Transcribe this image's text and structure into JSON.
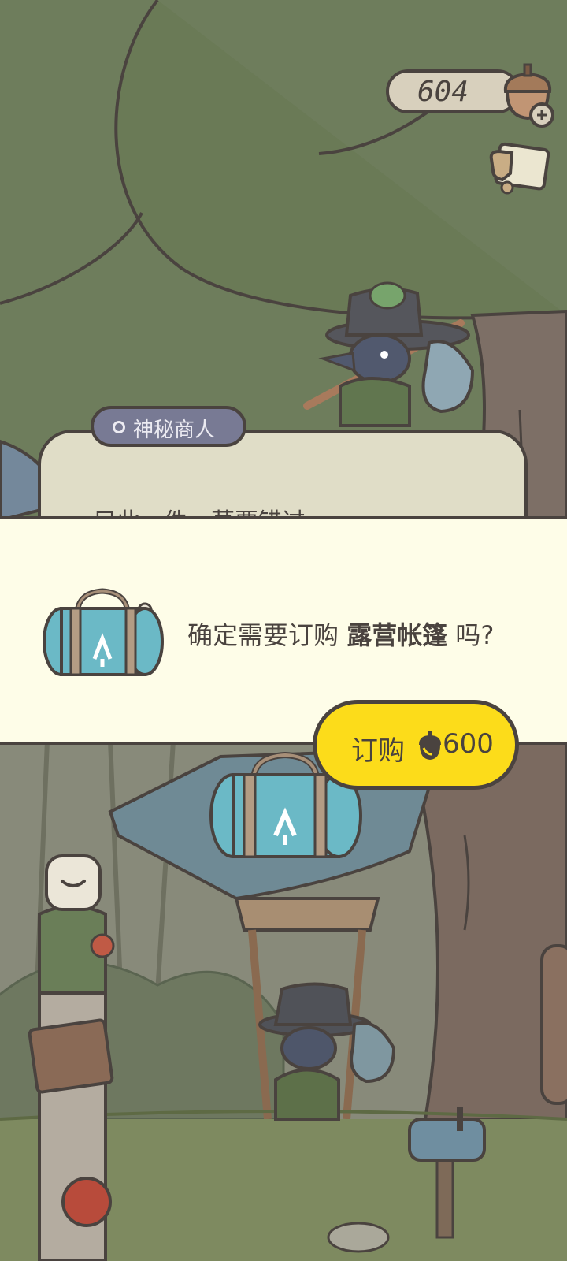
{
  "hud": {
    "acorn_count": "604",
    "acorn_icon": "acorn-icon",
    "mail_icon": "letter-icon"
  },
  "merchant": {
    "tab_label": "神秘商人",
    "dialog_partial": "只此一件，莫要错过"
  },
  "confirm": {
    "prefix": "确定需要订购 ",
    "item_name": "露营帐篷",
    "suffix": " 吗?",
    "item_icon": "camping-bag-icon"
  },
  "buy": {
    "label": "订购",
    "price": "600",
    "currency_icon": "acorn-icon"
  },
  "colors": {
    "forest": "#6e7d5c",
    "panel": "#fefde8",
    "button": "#fcdc1a",
    "outline": "#4a433f",
    "merchant_tab": "#787a94",
    "bag": "#6bb9c6"
  }
}
